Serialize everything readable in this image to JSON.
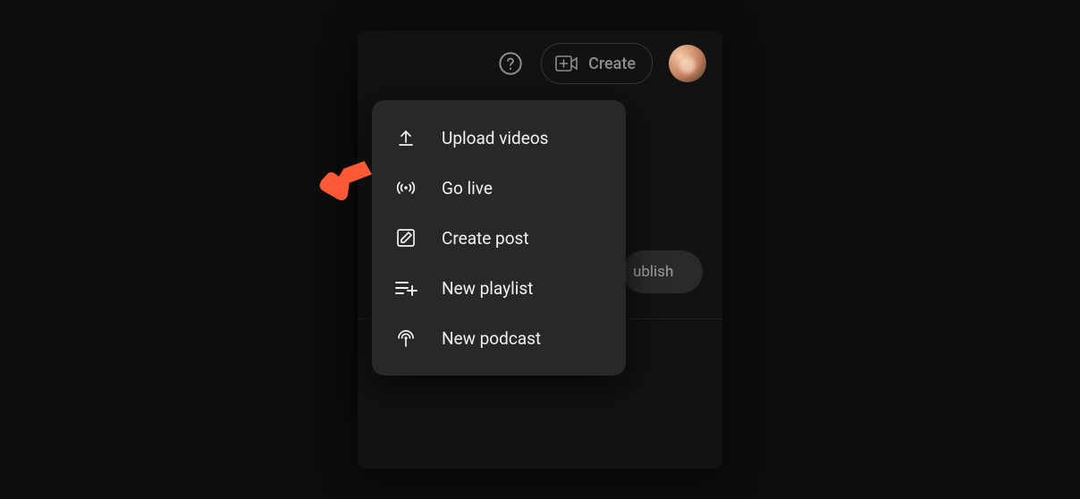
{
  "header": {
    "create_label": "Create"
  },
  "background": {
    "publish_label": "ublish"
  },
  "create_menu": {
    "items": [
      {
        "label": "Upload videos"
      },
      {
        "label": "Go live"
      },
      {
        "label": "Create post"
      },
      {
        "label": "New playlist"
      },
      {
        "label": "New podcast"
      }
    ]
  }
}
